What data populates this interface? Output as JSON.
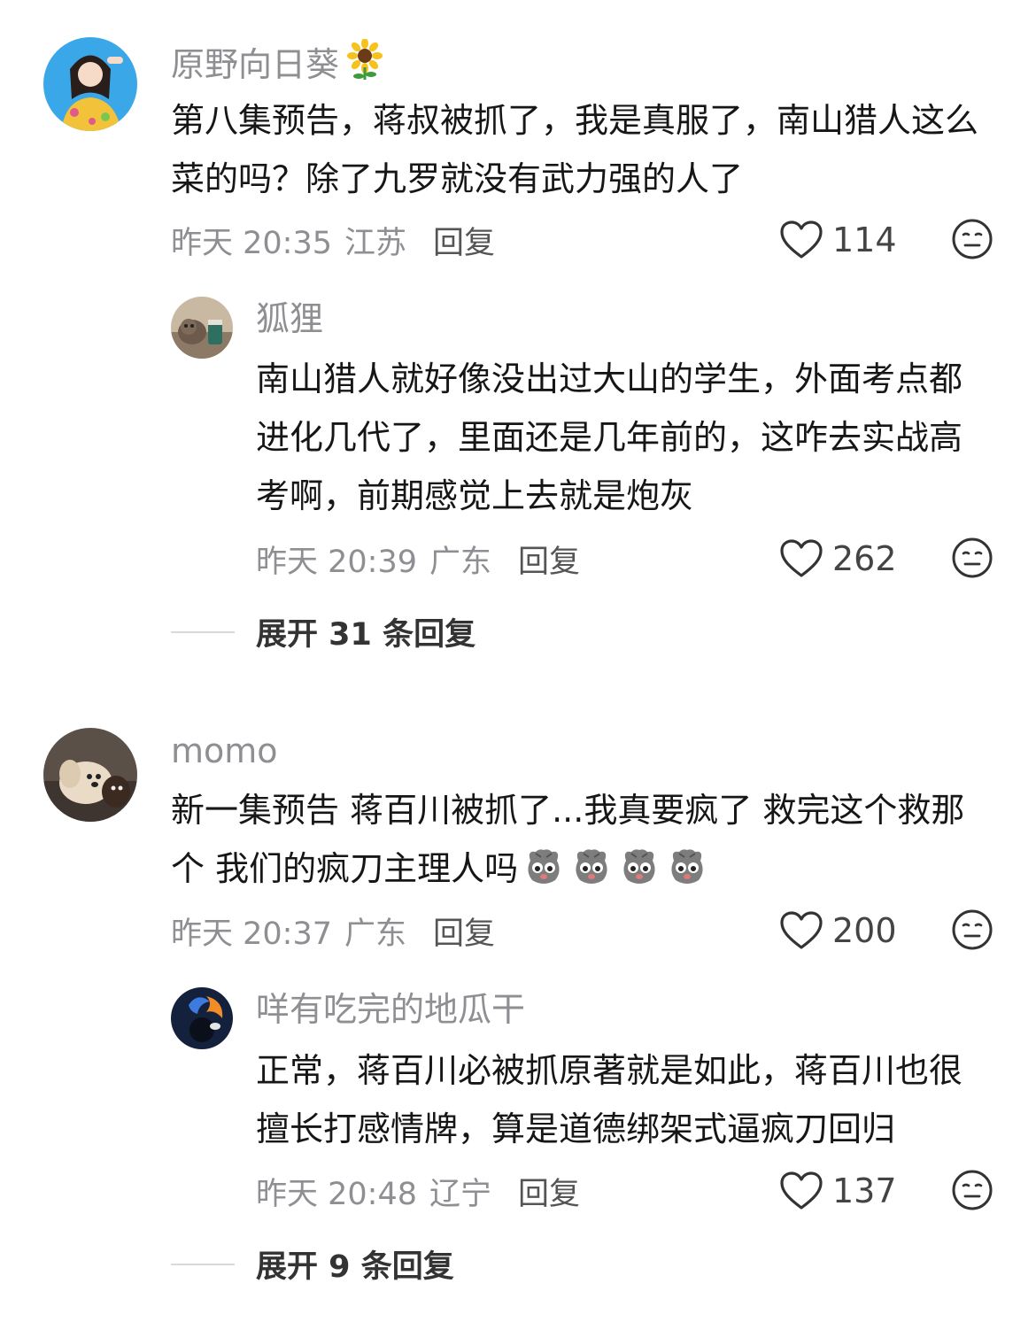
{
  "comments": [
    {
      "user": "原野向日葵",
      "text": "第八集预告，蒋叔被抓了，我是真服了，南山猎人这么菜的吗？除了九罗就没有武力强的人了",
      "time": "昨天 20:35",
      "location": "江苏",
      "reply_label": "回复",
      "likes": "114",
      "replies": [
        {
          "user": "狐狸",
          "text": "南山猎人就好像没出过大山的学生，外面考点都进化几代了，里面还是几年前的，这咋去实战高考啊，前期感觉上去就是炮灰",
          "time": "昨天 20:39",
          "location": "广东",
          "reply_label": "回复",
          "likes": "262"
        }
      ],
      "expand_label": "展开 31 条回复"
    },
    {
      "user": "momo",
      "text": "新一集预告 蒋百川被抓了...我真要疯了 救完这个救那个 我们的疯刀主理人吗",
      "time": "昨天 20:37",
      "location": "广东",
      "reply_label": "回复",
      "likes": "200",
      "emoji_count": 4,
      "replies": [
        {
          "user": "咩有吃完的地瓜干",
          "text": "正常，蒋百川必被抓原著就是如此，蒋百川也很擅长打感情牌，算是道德绑架式逼疯刀回归",
          "time": "昨天 20:48",
          "location": "辽宁",
          "reply_label": "回复",
          "likes": "137"
        }
      ],
      "expand_label": "展开 9 条回复"
    }
  ],
  "icons": {
    "like": "heart-outline-icon",
    "dislike": "neutral-face-icon",
    "badge": "sunflower-icon",
    "emoji": "dog-face-emoji"
  }
}
